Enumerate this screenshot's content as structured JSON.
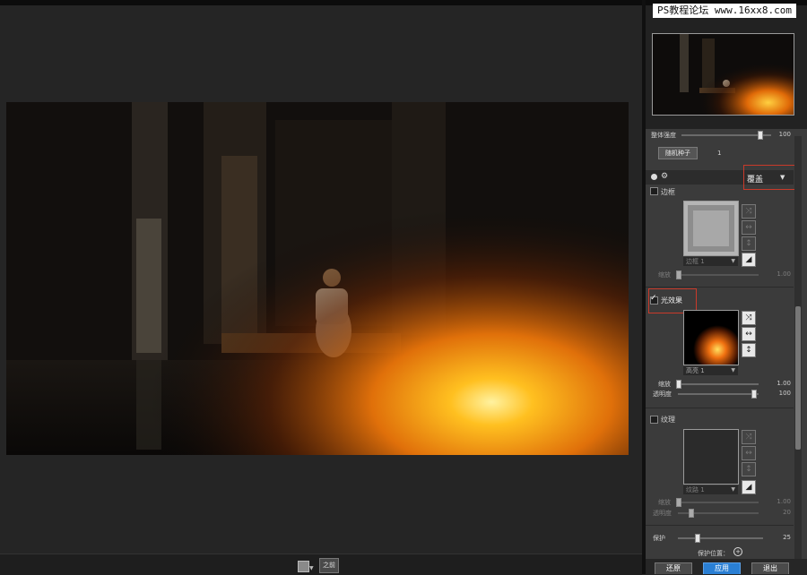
{
  "watermark": "PS教程论坛 www.16xx8.com",
  "canvas": {
    "before_label": "之前",
    "preview_alt": "kneeling woman in dark hall with orange light flare"
  },
  "panel": {
    "overall_opacity": {
      "label": "整体强度",
      "value": "100",
      "level": 0.95
    },
    "random_seed": {
      "button": "随机种子",
      "value": "1"
    },
    "blend_mode": {
      "value": "覆盖"
    },
    "border": {
      "label": "边框",
      "enabled": false,
      "preset": "边框 1",
      "scale_label": "缩放",
      "scale_value": "1.00"
    },
    "light": {
      "label": "光效果",
      "enabled": true,
      "preset": "高亮 1",
      "scale_label": "缩放",
      "scale_value": "1.00",
      "opacity_label": "透明度",
      "opacity_value": "100"
    },
    "texture": {
      "label": "纹理",
      "enabled": false,
      "preset": "纹路 1",
      "scale_label": "缩放",
      "scale_value": "1.00",
      "opacity_label": "透明度",
      "opacity_value": "20"
    },
    "protect": {
      "label": "保护",
      "value": "25",
      "level": 0.25,
      "position_label": "保护位置："
    },
    "footer": {
      "reset": "还原",
      "apply": "应用",
      "exit": "退出"
    }
  },
  "colors": {
    "accent": "#2a7fd4",
    "highlight_box": "#c93a2a",
    "flare": "#ffb020"
  }
}
